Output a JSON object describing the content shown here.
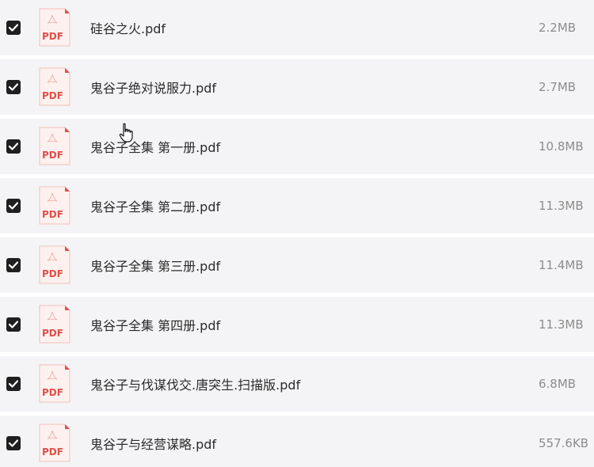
{
  "files": [
    {
      "name": "硅谷之火.pdf",
      "size": "2.2MB",
      "checked": true,
      "icon": "pdf-file-icon",
      "icon_label": "PDF"
    },
    {
      "name": "鬼谷子绝对说服力.pdf",
      "size": "2.7MB",
      "checked": true,
      "icon": "pdf-file-icon",
      "icon_label": "PDF"
    },
    {
      "name": "鬼谷子全集 第一册.pdf",
      "size": "10.8MB",
      "checked": true,
      "icon": "pdf-file-icon",
      "icon_label": "PDF"
    },
    {
      "name": "鬼谷子全集 第二册.pdf",
      "size": "11.3MB",
      "checked": true,
      "icon": "pdf-file-icon",
      "icon_label": "PDF"
    },
    {
      "name": "鬼谷子全集 第三册.pdf",
      "size": "11.4MB",
      "checked": true,
      "icon": "pdf-file-icon",
      "icon_label": "PDF"
    },
    {
      "name": "鬼谷子全集 第四册.pdf",
      "size": "11.3MB",
      "checked": true,
      "icon": "pdf-file-icon",
      "icon_label": "PDF"
    },
    {
      "name": "鬼谷子与伐谋伐交.唐突生.扫描版.pdf",
      "size": "6.8MB",
      "checked": true,
      "icon": "pdf-file-icon",
      "icon_label": "PDF"
    },
    {
      "name": "鬼谷子与经营谋略.pdf",
      "size": "557.6KB",
      "checked": true,
      "icon": "pdf-file-icon",
      "icon_label": "PDF"
    }
  ],
  "colors": {
    "row_background": "#f4f4f6",
    "checkbox_fill": "#1f1f1f",
    "pdf_accent": "#e0504a",
    "pdf_page": "#fdf1ef",
    "name_text": "#2b2b2b",
    "size_text": "#8c8c8c"
  },
  "cursor": {
    "icon": "hand-pointer-icon"
  }
}
